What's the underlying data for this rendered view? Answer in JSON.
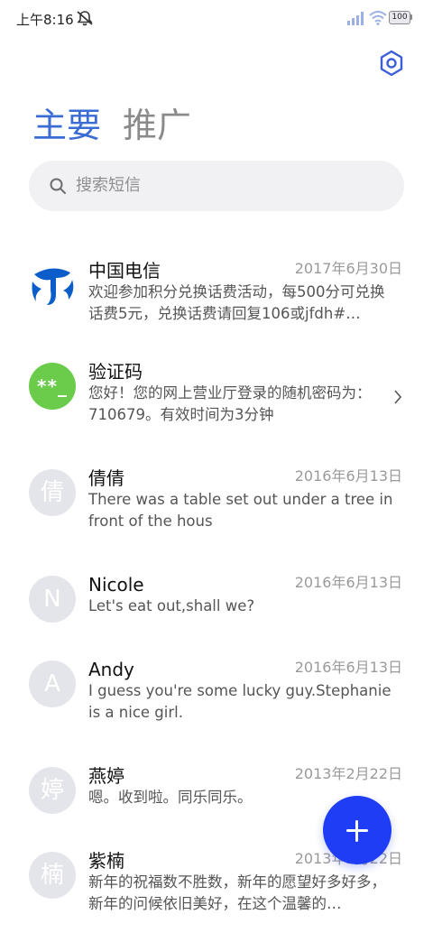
{
  "status_bar": {
    "time": "上午8:16",
    "battery": "100",
    "icons": [
      "mute-icon",
      "signal-icon",
      "wifi-icon",
      "battery-icon"
    ]
  },
  "header": {
    "settings_icon": "hexagon-gear-icon",
    "tabs": [
      {
        "label": "主要",
        "active": true
      },
      {
        "label": "推广",
        "active": false
      }
    ]
  },
  "search": {
    "placeholder": "搜索短信",
    "icon": "search-icon"
  },
  "conversations": [
    {
      "name": "中国电信",
      "date": "2017年6月30日",
      "preview": "欢迎参加积分兑换话费活动，每500分可兑换话费5元，兑换话费请回复106或jfdh#…",
      "avatar": "china-telecom-logo"
    },
    {
      "name": "验证码",
      "date": "",
      "preview": "您好！您的网上营业厅登录的随机密码为：710679。有效时间为3分钟",
      "avatar": "**_"
    },
    {
      "name": "倩倩",
      "date": "2016年6月13日",
      "preview": "There was a table set out under a tree in front of the hous",
      "avatar": "倩"
    },
    {
      "name": "Nicole",
      "date": "2016年6月13日",
      "preview": "Let's eat out,shall we?",
      "avatar": "N"
    },
    {
      "name": "Andy",
      "date": "2016年6月13日",
      "preview": "I guess you're some lucky guy.Stephanie is a nice girl.",
      "avatar": "A"
    },
    {
      "name": "燕婷",
      "date": "2013年2月22日",
      "preview": "嗯。收到啦。同乐同乐。",
      "avatar": "婷"
    },
    {
      "name": "紫楠",
      "date": "2013年2月22日",
      "preview": "新年的祝福数不胜数，新年的愿望好多好多，新年的问候依旧美好，在这个温馨的…",
      "avatar": "楠"
    }
  ],
  "fab": {
    "icon": "plus-icon",
    "color": "#1f3df5"
  },
  "colors": {
    "accent": "#3b6cd4",
    "verification_avatar": "#6acc4a",
    "telecom_logo": "#0b5ec9"
  }
}
